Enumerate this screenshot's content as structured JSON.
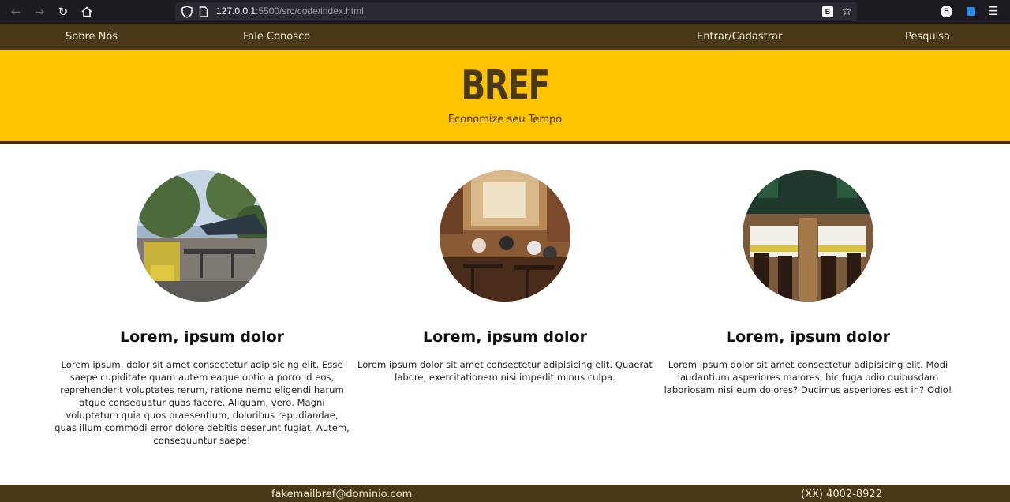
{
  "browser": {
    "url_host": "127.0.0.1",
    "url_path": ":5500/src/code/index.html",
    "icons": [
      "back-arrow-icon",
      "forward-arrow-icon",
      "reload-icon",
      "home-icon",
      "shield-icon",
      "page-icon",
      "reader-icon",
      "star-icon",
      "extension-icon",
      "menu-icon"
    ],
    "extension_letter": "B",
    "reader_letter": "B"
  },
  "nav": {
    "items": [
      "Sobre Nós",
      "Fale Conosco",
      "Entrar/Cadastrar",
      "Pesquisa"
    ]
  },
  "header": {
    "brand": "BREF",
    "tagline": "Economize seu Tempo"
  },
  "cards": [
    {
      "title": "Lorem, ipsum dolor",
      "text": "Lorem ipsum, dolor sit amet consectetur adipisicing elit. Esse saepe cupiditate quam autem eaque optio a porro id eos, reprehenderit voluptates rerum, ratione nemo eligendi harum atque consequatur quas facere. Aliquam, vero. Magni voluptatum quia quos praesentium, doloribus repudiandae, quas illum commodi error dolore debitis deserunt fugiat. Autem, consequuntur saepe!",
      "image": "outdoor-patio-restaurant"
    },
    {
      "title": "Lorem, ipsum dolor",
      "text": "Lorem ipsum dolor sit amet consectetur adipisicing elit. Quaerat labore, exercitationem nisi impedit minus culpa.",
      "image": "indoor-restaurant-diners"
    },
    {
      "title": "Lorem, ipsum dolor",
      "text": "Lorem ipsum dolor sit amet consectetur adipisicing elit. Modi laudantium asperiores maiores, hic fuga odio quibusdam laboriosam nisi eum dolores? Ducimus asperiores est in? Odio!",
      "image": "dining-hall-tables"
    }
  ],
  "footer": {
    "email": "fakemailbref@dominio.com",
    "phone": "(XX) 4002-8922"
  },
  "colors": {
    "nav_bg": "#4a3916",
    "header_bg": "#ffc300",
    "brand_text": "#4a3916",
    "browser_bg": "#1c1b22"
  }
}
